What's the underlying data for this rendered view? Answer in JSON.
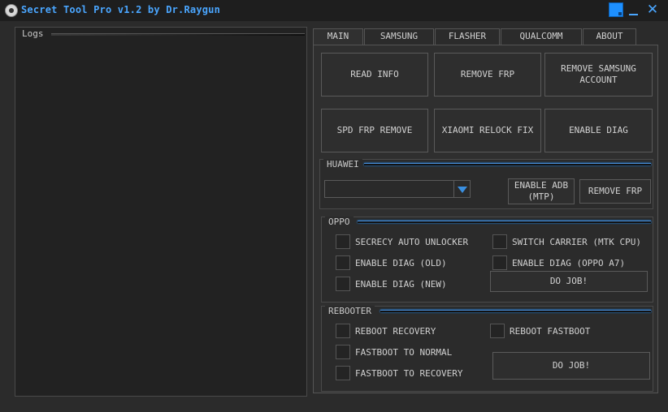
{
  "window": {
    "title": "Secret Tool Pro v1.2 by Dr.Raygun",
    "close_glyph": "✕"
  },
  "logs": {
    "label": "Logs"
  },
  "tabs": [
    {
      "label": "MAIN"
    },
    {
      "label": "SAMSUNG"
    },
    {
      "label": "FLASHER"
    },
    {
      "label": "QUALCOMM"
    },
    {
      "label": "ABOUT"
    }
  ],
  "main_buttons": {
    "read_info": "READ INFO",
    "remove_frp": "REMOVE FRP",
    "remove_samsung_account": "REMOVE SAMSUNG ACCOUNT",
    "spd_frp_remove": "SPD FRP REMOVE",
    "xiaomi_relock_fix": "XIAOMI RELOCK FIX",
    "enable_diag": "ENABLE DIAG"
  },
  "huawei": {
    "label": "HUAWEI",
    "combo_value": "",
    "enable_adb": "ENABLE ADB (MTP)",
    "remove_frp": "REMOVE FRP"
  },
  "oppo": {
    "label": "OPPO",
    "secrecy_auto_unlocker": "SECRECY AUTO UNLOCKER",
    "switch_carrier": "SWITCH CARRIER (MTK CPU)",
    "enable_diag_old": "ENABLE DIAG (OLD)",
    "enable_diag_oppo_a7": "ENABLE DIAG (OPPO A7)",
    "enable_diag_new": "ENABLE DIAG (NEW)",
    "do_job": "DO JOB!"
  },
  "rebooter": {
    "label": "REBOOTER",
    "reboot_recovery": "REBOOT RECOVERY",
    "reboot_fastboot": "REBOOT FASTBOOT",
    "fastboot_to_normal": "FASTBOOT TO NORMAL",
    "fastboot_to_recovery": "FASTBOOT TO RECOVERY",
    "do_job": "DO JOB!"
  }
}
